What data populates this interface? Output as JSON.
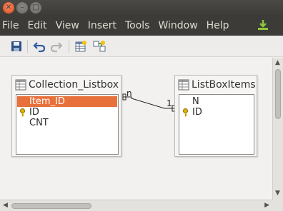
{
  "menu": [
    "File",
    "Edit",
    "View",
    "Insert",
    "Tools",
    "Window",
    "Help"
  ],
  "toolbar": {
    "buttons": [
      "save-icon",
      "undo-icon",
      "redo-icon",
      "new-table-icon",
      "new-relation-icon"
    ]
  },
  "tables": [
    {
      "title": "Collection_Listbox",
      "fields": [
        {
          "name": "Item_ID",
          "key": false,
          "selected": true
        },
        {
          "name": "ID",
          "key": true,
          "selected": false
        },
        {
          "name": "CNT",
          "key": false,
          "selected": false
        }
      ]
    },
    {
      "title": "ListBoxItems",
      "fields": [
        {
          "name": "N",
          "key": false,
          "selected": false
        },
        {
          "name": "ID",
          "key": true,
          "selected": false
        }
      ]
    }
  ],
  "relation": {
    "left_label": "n",
    "right_label": "1"
  },
  "colors": {
    "selection": "#e8703a",
    "menubar": "#3c3b37"
  }
}
